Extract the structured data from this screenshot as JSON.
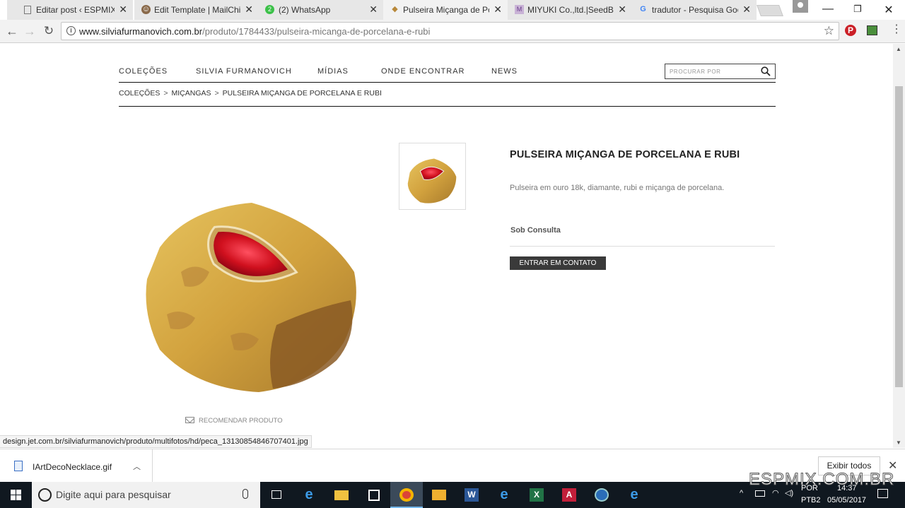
{
  "browser": {
    "tabs": [
      {
        "label": "Editar post ‹ ESPMIX —",
        "favicon": "page-icon"
      },
      {
        "label": "Edit Template | MailChim",
        "favicon": "mailchimp-icon"
      },
      {
        "label": "(2) WhatsApp",
        "favicon": "whatsapp-icon"
      },
      {
        "label": "Pulseira Miçanga de Por",
        "favicon": "site-diamond-icon",
        "active": true
      },
      {
        "label": "MIYUKI Co.,ltd.|SeedBea",
        "favicon": "miyuki-icon"
      },
      {
        "label": "tradutor - Pesquisa Goo",
        "favicon": "google-icon"
      }
    ],
    "url_host": "www.silviafurmanovich.com.br",
    "url_path": "/produto/1784433/pulseira-micanga-de-porcelana-e-rubi",
    "status_url": "design.jet.com.br/silviafurmanovich/produto/multifotos/hd/peca_13130854846707401.jpg"
  },
  "site": {
    "nav": [
      "COLEÇÕES",
      "SILVIA FURMANOVICH",
      "MÍDIAS",
      "ONDE ENCONTRAR",
      "NEWS"
    ],
    "search_placeholder": "PROCURAR POR",
    "breadcrumb": [
      "COLEÇÕES",
      "MIÇANGAS",
      "PULSEIRA MIÇANGA DE PORCELANA E RUBI"
    ],
    "breadcrumb_sep": ">",
    "recommend": "RECOMENDAR PRODUTO"
  },
  "product": {
    "title": "PULSEIRA MIÇANGA DE PORCELANA E RUBI",
    "description": "Pulseira em ouro 18k, diamante, rubi e miçanga de porcelana.",
    "price": "Sob Consulta",
    "button": "ENTRAR EM CONTATO"
  },
  "downloads": {
    "file": "IArtDecoNecklace.gif",
    "show_all": "Exibir todos"
  },
  "watermark": "ESPMIX.COM.BR",
  "taskbar": {
    "search_placeholder": "Digite aqui para pesquisar",
    "lang1": "POR",
    "lang2": "PTB2",
    "time": "14:37",
    "date": "05/05/2017"
  }
}
